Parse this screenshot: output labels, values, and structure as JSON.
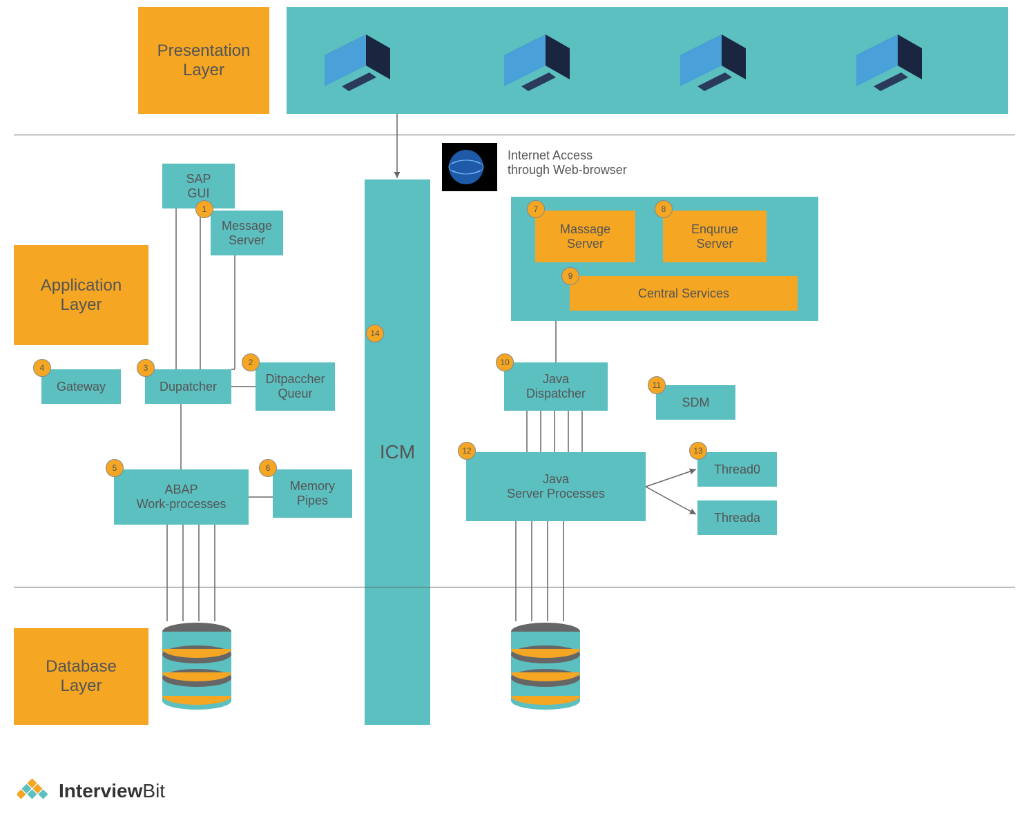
{
  "layers": {
    "presentation": "Presentation\nLayer",
    "application": "Application\nLayer",
    "database": "Database\nLayer"
  },
  "boxes": {
    "sap_gui": "SAP\nGUI",
    "message_server": "Message\nServer",
    "gateway": "Gateway",
    "dispatcher": "Dupatcher",
    "dispatcher_queue": "Ditpaccher\nQueur",
    "abap_wp": "ABAP\nWork-processes",
    "memory_pipes": "Memory\nPipes",
    "icm": "ICM",
    "massage_server": "Massage\nServer",
    "enqueue_server": "Enqurue\nServer",
    "central_services": "Central Services",
    "java_dispatcher": "Java\nDispatcher",
    "sdm": "SDM",
    "java_server_processes": "Java\nServer Processes",
    "thread0": "Thread0",
    "threada": "Threada"
  },
  "badges": {
    "b1": "1",
    "b2": "2",
    "b3": "3",
    "b4": "4",
    "b5": "5",
    "b6": "6",
    "b7": "7",
    "b8": "8",
    "b9": "9",
    "b10": "10",
    "b11": "11",
    "b12": "12",
    "b13": "13",
    "b14": "14"
  },
  "labels": {
    "internet_access": "Internet Access\nthrough Web-browser"
  },
  "brand": {
    "part1": "Interview",
    "part2": "Bit"
  }
}
